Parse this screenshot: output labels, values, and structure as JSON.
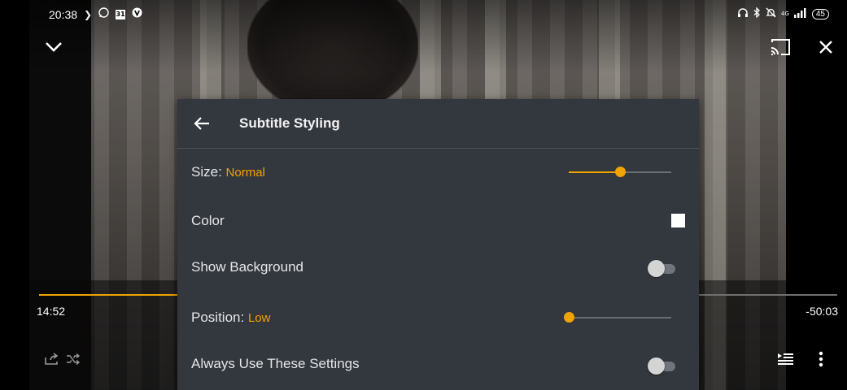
{
  "status_bar": {
    "time": "20:38",
    "notification_icons": [
      "chevron-right-icon",
      "whatsapp-icon",
      "calendar-icon",
      "vpn-icon"
    ],
    "calendar_day": "31",
    "right_icons": [
      "headphones-icon",
      "bluetooth-icon",
      "mute-icon",
      "signal-icon"
    ],
    "network": "4G",
    "battery": "45"
  },
  "player": {
    "elapsed": "14:52",
    "remaining": "-50:03",
    "progress": 0.23,
    "accent_color": "#f0a400"
  },
  "dialog": {
    "title": "Subtitle Styling",
    "size": {
      "label": "Size:",
      "value": "Normal",
      "level": 0.5
    },
    "color": {
      "label": "Color",
      "swatch": "#ffffff"
    },
    "show_background": {
      "label": "Show Background",
      "enabled": false
    },
    "position": {
      "label": "Position:",
      "value": "Low",
      "level": 0.0
    },
    "always_use": {
      "label": "Always Use These Settings",
      "enabled": false
    }
  }
}
